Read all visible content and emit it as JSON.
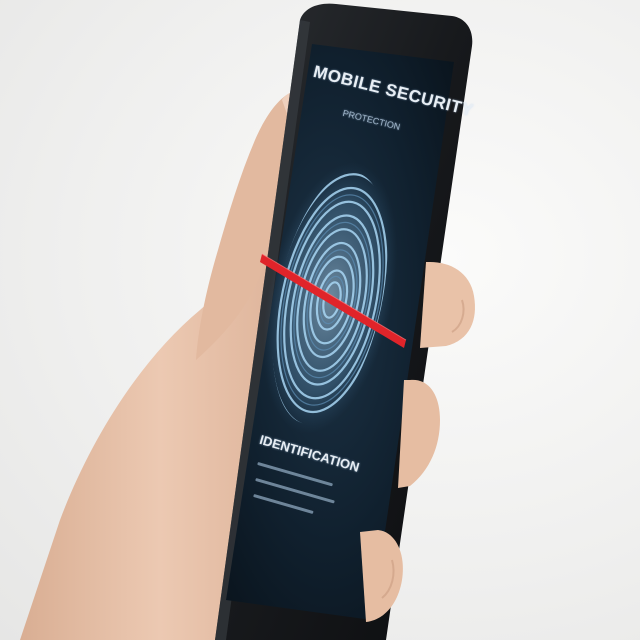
{
  "screen": {
    "title": "MOBILE SECURITY",
    "subtitle": "PROTECTION",
    "status_label": "IDENTIFICATION"
  },
  "colors": {
    "background": "#f1f1f0",
    "phone_body": "#1b1d20",
    "screen_bg": "#0f1a24",
    "fingerprint": "#8fc2e6",
    "scan_line": "#e0242a",
    "skin": "#e7c3ab"
  },
  "icons": [
    "fingerprint-icon",
    "scan-line"
  ]
}
